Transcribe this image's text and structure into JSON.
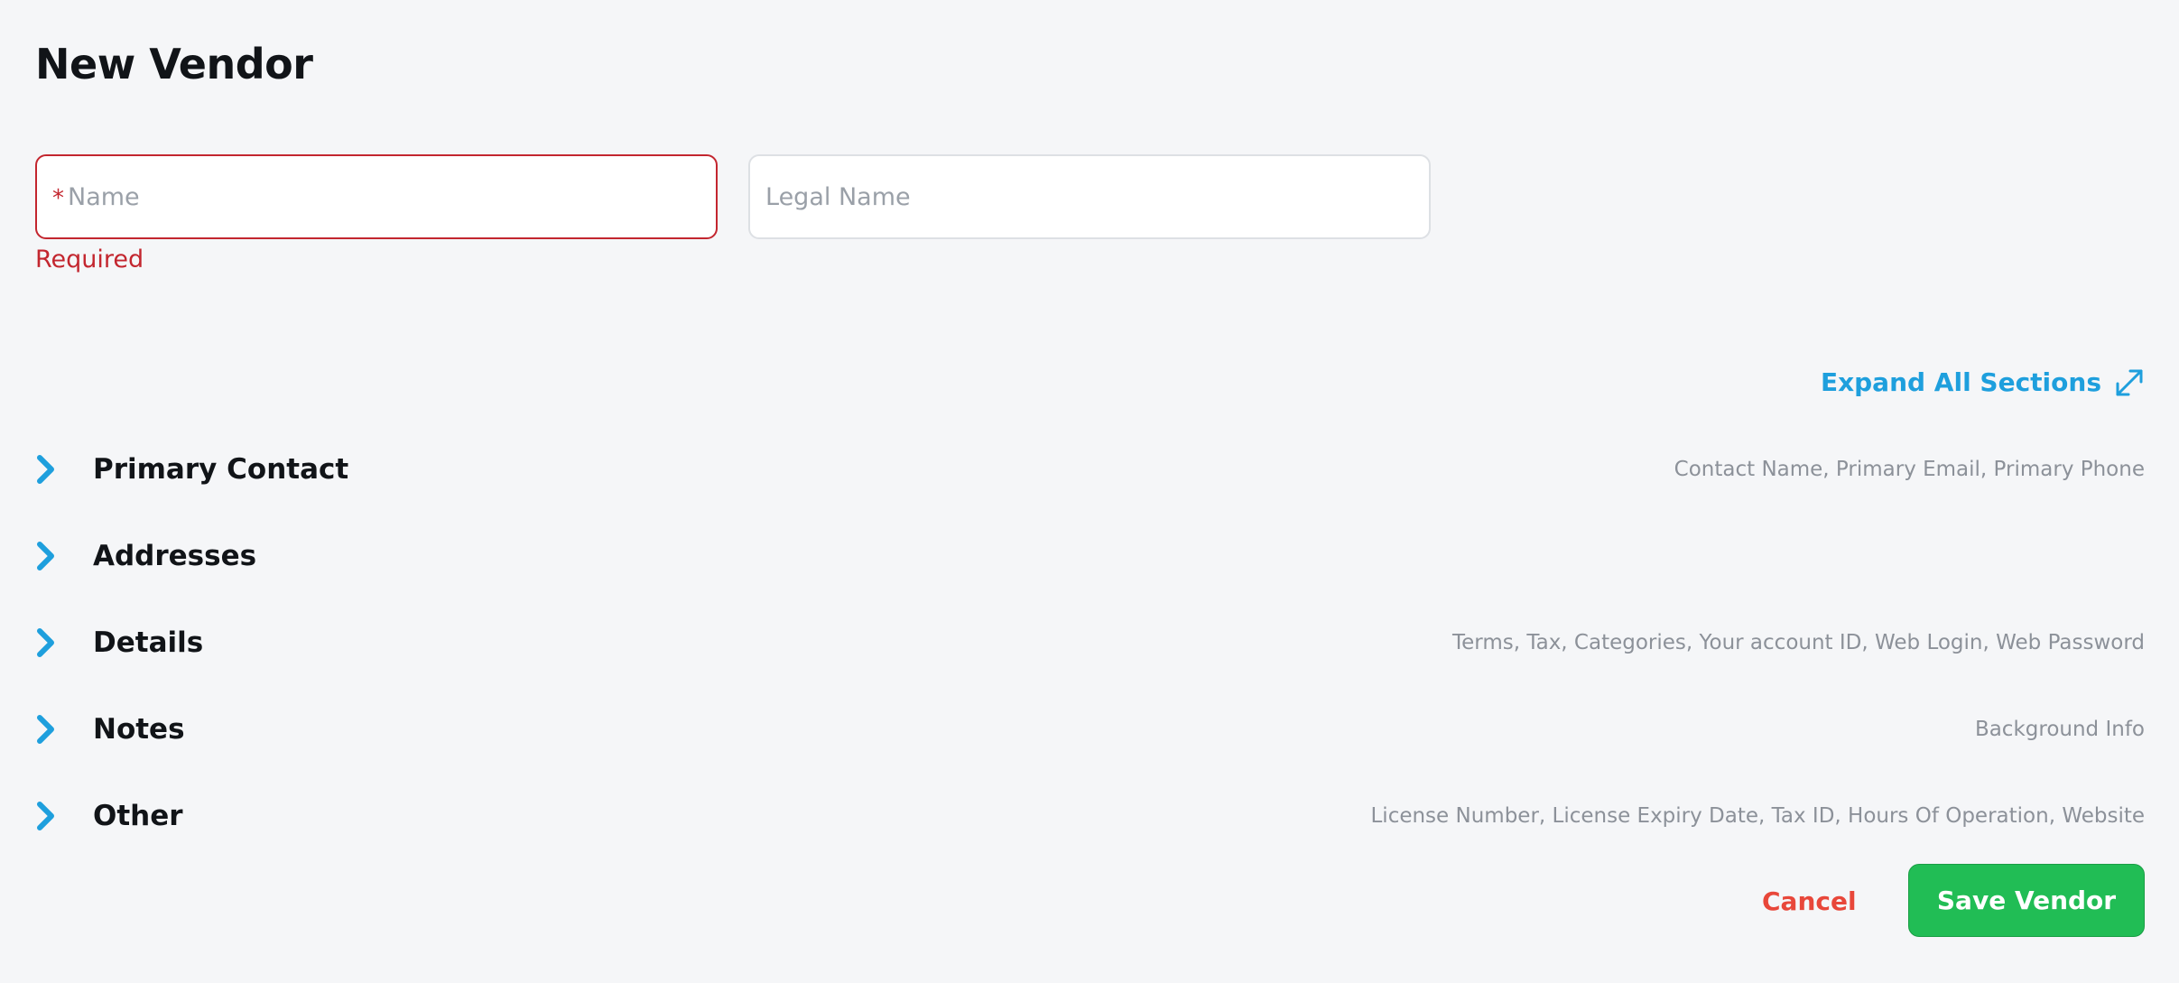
{
  "page": {
    "title": "New Vendor"
  },
  "form": {
    "name": {
      "required_marker": "*",
      "placeholder": "Name",
      "value": "",
      "error": "Required"
    },
    "legal_name": {
      "placeholder": "Legal Name",
      "value": ""
    }
  },
  "expand_all": {
    "label": "Expand All Sections",
    "icon": "expand-arrows-icon"
  },
  "sections": [
    {
      "title": "Primary Contact",
      "summary": "Contact Name, Primary Email, Primary Phone"
    },
    {
      "title": "Addresses",
      "summary": ""
    },
    {
      "title": "Details",
      "summary": "Terms, Tax, Categories, Your account ID, Web Login, Web Password"
    },
    {
      "title": "Notes",
      "summary": "Background Info"
    },
    {
      "title": "Other",
      "summary": "License Number, License Expiry Date, Tax ID, Hours Of Operation, Website"
    }
  ],
  "actions": {
    "cancel_label": "Cancel",
    "save_label": "Save Vendor"
  },
  "colors": {
    "accent": "#1e9fdd",
    "error": "#c3262f",
    "cancel": "#e8473a",
    "save": "#21bd55",
    "background": "#f5f6f8"
  }
}
